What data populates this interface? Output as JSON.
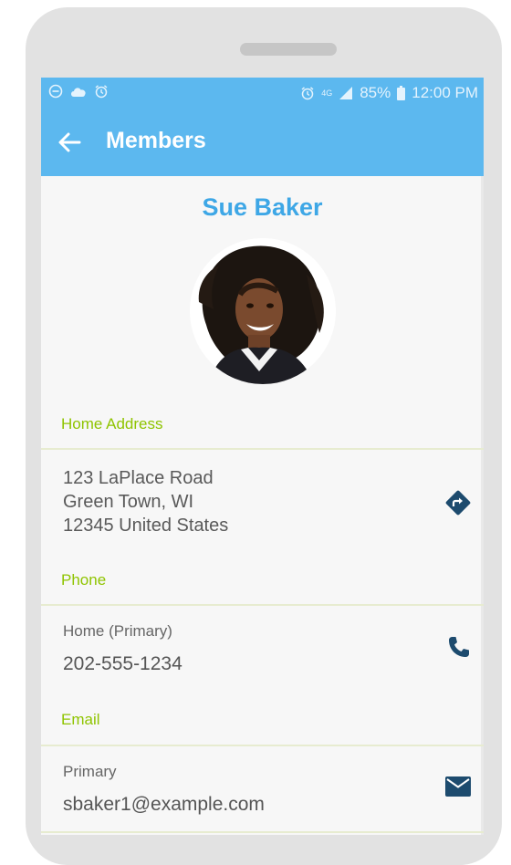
{
  "status_bar": {
    "left_icons": [
      "minus-circle-icon",
      "cloud-icon",
      "alarm-icon"
    ],
    "right_icons": [
      "alarm-icon",
      "4g-data-icon",
      "signal-icon",
      "battery-icon"
    ],
    "network": "4G",
    "battery": "85%",
    "time": "12:00 PM"
  },
  "app_bar": {
    "back_icon": "arrow-left-icon",
    "title": "Members"
  },
  "profile": {
    "name": "Sue Baker",
    "avatar": "member-photo"
  },
  "home_address": {
    "label": "Home Address",
    "line1": "123 LaPlace Road",
    "line2": "Green Town, WI",
    "line3": "12345 United States",
    "action_icon": "directions-icon"
  },
  "phone": {
    "label": "Phone",
    "type": "Home (Primary)",
    "number": "202-555-1234",
    "action_icon": "phone-icon"
  },
  "email": {
    "label": "Email",
    "type": "Primary",
    "address": "sbaker1@example.com",
    "action_icon": "mail-icon"
  },
  "colors": {
    "app_bar": "#5cb8ef",
    "name": "#3ea7e6",
    "section_label": "#8fc400",
    "action_icon": "#1d4b6e",
    "device": "#e2e2e2"
  }
}
